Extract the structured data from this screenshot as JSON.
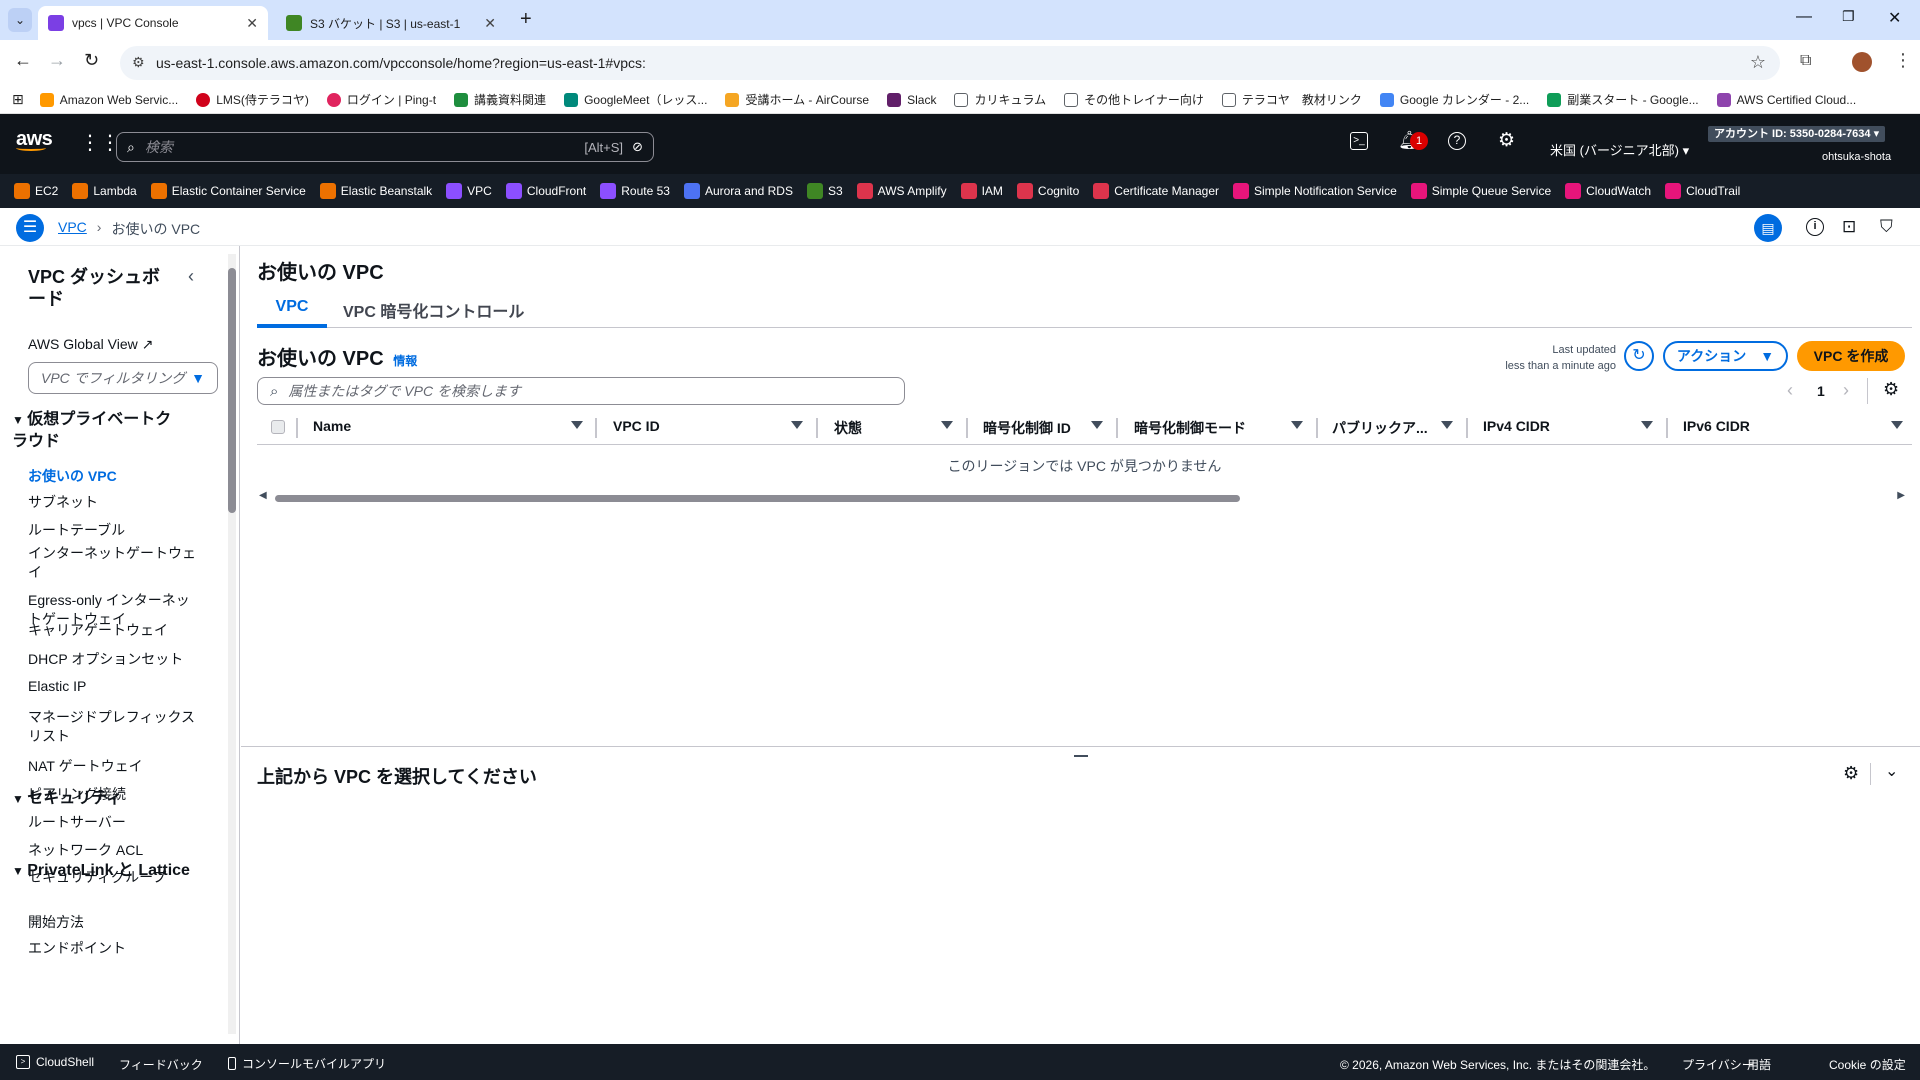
{
  "browser": {
    "tabs": [
      {
        "title": "vpcs | VPC Console",
        "active": true,
        "color": "#7b3fe4"
      },
      {
        "title": "S3 バケット | S3 | us-east-1",
        "active": false,
        "color": "#3f8624"
      }
    ],
    "url": "us-east-1.console.aws.amazon.com/vpcconsole/home?region=us-east-1#vpcs:",
    "bookmarks": [
      {
        "label": "Amazon Web Servic...",
        "color": "#ff9900"
      },
      {
        "label": "LMS(侍テラコヤ)",
        "color": "#d0021b"
      },
      {
        "label": "ログイン | Ping-t",
        "color": "#e0245e"
      },
      {
        "label": "講義資料関連",
        "color": "#1e8e3e"
      },
      {
        "label": "GoogleMeet（レッス...",
        "color": "#00897b"
      },
      {
        "label": "受講ホーム - AirCourse",
        "color": "#f5a623"
      },
      {
        "label": "Slack",
        "color": "#611f69"
      },
      {
        "label": "カリキュラム",
        "color": "#5f6368"
      },
      {
        "label": "その他トレイナー向け",
        "color": "#5f6368"
      },
      {
        "label": "テラコヤ　教材リンク",
        "color": "#5f6368"
      },
      {
        "label": "Google カレンダー - 2...",
        "color": "#4285f4"
      },
      {
        "label": "副業スタート - Google...",
        "color": "#0f9d58"
      },
      {
        "label": "AWS Certified Cloud...",
        "color": "#8e44ad"
      }
    ]
  },
  "awsnav": {
    "logo": "aws",
    "search_placeholder": "検索",
    "search_shortcut": "[Alt+S]",
    "notification_count": "1",
    "region": "米国 (バージニア北部)",
    "account": "アカウント ID: 5350-0284-7634",
    "user": "ohtsuka-shota",
    "services": [
      {
        "label": "EC2",
        "color": "#ed7100"
      },
      {
        "label": "Lambda",
        "color": "#ed7100"
      },
      {
        "label": "Elastic Container Service",
        "color": "#ed7100"
      },
      {
        "label": "Elastic Beanstalk",
        "color": "#ed7100"
      },
      {
        "label": "VPC",
        "color": "#8c4fff"
      },
      {
        "label": "CloudFront",
        "color": "#8c4fff"
      },
      {
        "label": "Route 53",
        "color": "#8c4fff"
      },
      {
        "label": "Aurora and RDS",
        "color": "#4d72f3"
      },
      {
        "label": "S3",
        "color": "#3f8624"
      },
      {
        "label": "AWS Amplify",
        "color": "#dd344c"
      },
      {
        "label": "IAM",
        "color": "#dd344c"
      },
      {
        "label": "Cognito",
        "color": "#dd344c"
      },
      {
        "label": "Certificate Manager",
        "color": "#dd344c"
      },
      {
        "label": "Simple Notification Service",
        "color": "#e7157b"
      },
      {
        "label": "Simple Queue Service",
        "color": "#e7157b"
      },
      {
        "label": "CloudWatch",
        "color": "#e7157b"
      },
      {
        "label": "CloudTrail",
        "color": "#e7157b"
      }
    ]
  },
  "breadcrumb": {
    "root": "VPC",
    "current": "お使いの VPC"
  },
  "sidebar": {
    "title": "VPC ダッシュボード",
    "global_view": "AWS Global View",
    "filter_placeholder": "VPC でフィルタリング",
    "sections": [
      {
        "title": "仮想プライベートクラウド",
        "items": [
          "お使いの VPC",
          "サブネット",
          "ルートテーブル",
          "インターネットゲートウェイ",
          "Egress-only インターネットゲートウェイ",
          "キャリアゲートウェイ",
          "DHCP オプションセット",
          "Elastic IP",
          "マネージドプレフィックスリスト",
          "NAT ゲートウェイ",
          "ピアリング接続",
          "ルートサーバー"
        ]
      },
      {
        "title": "セキュリティ",
        "items": [
          "ネットワーク ACL",
          "セキュリティグループ"
        ]
      },
      {
        "title": "PrivateLink と Lattice",
        "items": [
          "開始方法",
          "エンドポイント"
        ]
      }
    ],
    "active_item": "お使いの VPC"
  },
  "main": {
    "page_title": "お使いの VPC",
    "tabs": [
      "VPC",
      "VPC 暗号化コントロール"
    ],
    "table_title": "お使いの VPC",
    "info_link": "情報",
    "last_updated_label": "Last updated",
    "last_updated_value": "less than a minute ago",
    "actions_label": "アクション",
    "create_label": "VPC を作成",
    "search_placeholder": "属性またはタグで VPC を検索します",
    "page_number": "1",
    "columns": [
      "Name",
      "VPC ID",
      "状態",
      "暗号化制御 ID",
      "暗号化制御モード",
      "パブリックア...",
      "IPv4 CIDR",
      "IPv6 CIDR"
    ],
    "empty_message": "このリージョンでは VPC が見つかりません"
  },
  "split": {
    "title": "上記から VPC を選択してください"
  },
  "footer": {
    "cloudshell": "CloudShell",
    "feedback": "フィードバック",
    "mobile_app": "コンソールモバイルアプリ",
    "copyright": "© 2026, Amazon Web Services, Inc. またはその関連会社。",
    "privacy": "プライバシー",
    "terms": "用語",
    "cookie": "Cookie の設定"
  }
}
